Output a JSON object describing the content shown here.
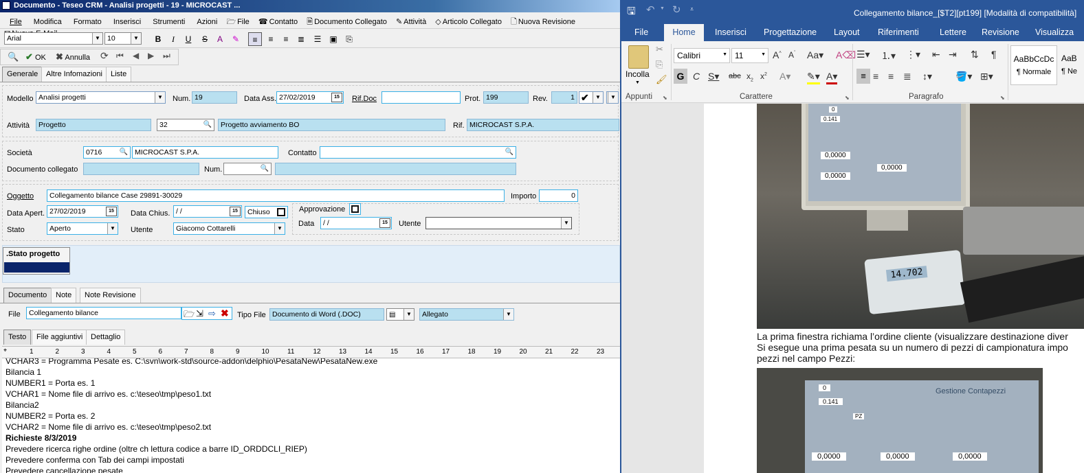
{
  "left_window": {
    "title": "Documento - Teseo CRM - Analisi progetti - 19 - MICROCAST ...",
    "menu": [
      "File",
      "Modifica",
      "Formato",
      "Inserisci",
      "Strumenti",
      "Azioni"
    ],
    "toolbar1": [
      "File",
      "Contatto",
      "Documento Collegato",
      "Attività",
      "Articolo Collegato",
      "Nuova Revisione",
      "Nuova E-Mail"
    ],
    "font_name": "Arial",
    "font_size": "10",
    "ok_label": "OK",
    "cancel_label": "Annulla",
    "main_tabs": [
      "Generale",
      "Altre Infomazioni",
      "Liste"
    ],
    "modello": {
      "label": "Modello",
      "value": "Analisi progetti"
    },
    "num": {
      "label": "Num.",
      "value": "19"
    },
    "data_ass": {
      "label": "Data Ass.",
      "value": "27/02/2019"
    },
    "rif_doc": {
      "label": "Rif.Doc",
      "value": ""
    },
    "prot": {
      "label": "Prot.",
      "value": "199"
    },
    "rev": {
      "label": "Rev.",
      "value": "1"
    },
    "attivita": {
      "label": "Attività",
      "value": "Progetto",
      "code": "32",
      "desc": "Progetto avviamento BO"
    },
    "rif": {
      "label": "Rif.",
      "value": "MICROCAST S.P.A."
    },
    "societa": {
      "label": "Società",
      "code": "0716",
      "name": "MICROCAST S.P.A."
    },
    "contatto": {
      "label": "Contatto",
      "value": ""
    },
    "doc_collegato": {
      "label": "Documento collegato",
      "num_label": "Num."
    },
    "oggetto": {
      "label": "Oggetto",
      "value": "Collegamento bilance Case 29891-30029"
    },
    "importo": {
      "label": "Importo",
      "value": "0"
    },
    "data_apert": {
      "label": "Data Apert.",
      "value": "27/02/2019"
    },
    "data_chius": {
      "label": "Data Chius.",
      "value": " /  /"
    },
    "chiuso": {
      "label": "Chiuso"
    },
    "approvazione": {
      "label": "Approvazione",
      "data_label": "Data",
      "data_value": " /  /",
      "utente_label": "Utente",
      "utente_value": ""
    },
    "stato": {
      "label": "Stato",
      "value": "Aperto"
    },
    "utente": {
      "label": "Utente",
      "value": "Giacomo Cottarelli"
    },
    "stato_progetto": ".Stato progetto",
    "doc_tabs": [
      "Documento",
      "Note",
      "Note Revisione"
    ],
    "file": {
      "label": "File",
      "value": "Collegamento bilance"
    },
    "tipo_file": {
      "label": "Tipo File",
      "value": "Documento di Word (.DOC)",
      "attach": "Allegato"
    },
    "text_tabs": [
      "Testo",
      "File aggiuntivi",
      "Dettaglio"
    ],
    "ruler": [
      "1",
      "2",
      "3",
      "4",
      "5",
      "6",
      "7",
      "8",
      "9",
      "10",
      "11",
      "12",
      "13",
      "14",
      "15",
      "16",
      "17",
      "18",
      "19",
      "20",
      "21",
      "22",
      "23"
    ],
    "text_lines": [
      {
        "t": "VCHAR3 = Programma Pesate es. C:\\svn\\work-std\\source-addon\\delphio\\PesataNew\\PesataNew.exe",
        "b": false
      },
      {
        "t": "Bilancia 1",
        "b": false
      },
      {
        "t": "NUMBER1 = Porta es. 1",
        "b": false
      },
      {
        "t": "VCHAR1 = Nome file di arrivo es. c:\\teseo\\tmp\\peso1.txt",
        "b": false
      },
      {
        "t": "Bilancia2",
        "b": false
      },
      {
        "t": "NUMBER2 = Porta es. 2",
        "b": false
      },
      {
        "t": "VCHAR2 = Nome file di arrivo es. c:\\teseo\\tmp\\peso2.txt",
        "b": false
      },
      {
        "t": "Richieste 8/3/2019",
        "b": true
      },
      {
        "t": "Prevedere ricerca righe ordine (oltre ch lettura codice a barre ID_ORDDCLI_RIEP)",
        "b": false
      },
      {
        "t": "Prevedere conferma con Tab dei campi impostati",
        "b": false
      },
      {
        "t": "Prevedere cancellazione pesate",
        "b": false
      }
    ]
  },
  "word": {
    "title": "Collegamento bilance_[$T2][pt199] [Modalità di compatibilità]",
    "tabs": [
      "File",
      "Home",
      "Inserisci",
      "Progettazione",
      "Layout",
      "Riferimenti",
      "Lettere",
      "Revisione",
      "Visualizza"
    ],
    "paste_label": "Incolla",
    "font_name": "Calibri",
    "font_size": "11",
    "group_labels": [
      "Appunti",
      "Carattere",
      "Paragrafo"
    ],
    "styles": [
      {
        "sample": "AaBbCcDc",
        "name": "¶ Normale"
      },
      {
        "sample": "AaB",
        "name": "¶ Ne"
      }
    ],
    "body_lines": [
      "La prima finestra richiama l’ordine cliente (visualizzare destinazione diver",
      " Si esegue una prima pesata su un numero di pezzi di campionatura impo",
      "pezzi nel campo Pezzi:"
    ],
    "scale_display": "14.702",
    "screen_text": {
      "title": "Gestione Contapezzi",
      "v1": "0,0000",
      "v2": "0,0000",
      "v3": "0,0000",
      "pz": "PZ",
      "qty": "0",
      "val": "0.141"
    }
  },
  "colors": {
    "word_blue": "#2b579a",
    "crm_field": "#b9e0f0",
    "progress": "#0a246a"
  }
}
